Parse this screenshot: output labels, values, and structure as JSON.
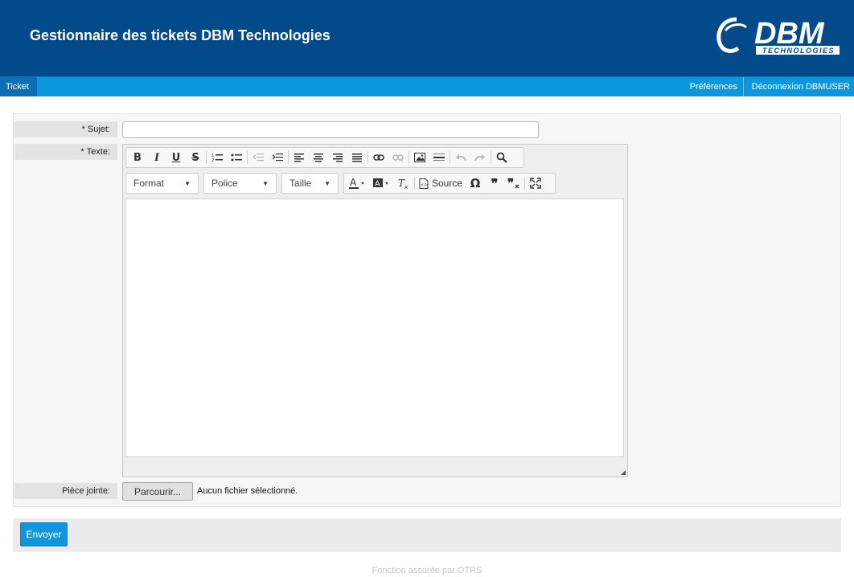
{
  "header": {
    "title": "Gestionnaire des tickets DBM Technologies",
    "logo_text": "DBM",
    "logo_sub": "TECHNOLOGIES"
  },
  "nav": {
    "ticket": "Ticket",
    "preferences": "Préférences",
    "logout": "Déconnexion DBMUSER"
  },
  "form": {
    "required_mark": "*",
    "subject_label": "Sujet:",
    "subject_value": "",
    "text_label": "Texte:",
    "attachment_label": "Pièce jointe:",
    "browse_label": "Parcourir...",
    "file_status": "Aucun fichier sélectionné."
  },
  "editor": {
    "format_label": "Format",
    "font_label": "Police",
    "size_label": "Taille",
    "source_label": "Source",
    "icons": [
      "bold-icon",
      "italic-icon",
      "underline-icon",
      "strike-icon",
      "numbered-list-icon",
      "bullet-list-icon",
      "outdent-icon",
      "indent-icon",
      "align-left-icon",
      "align-center-icon",
      "align-right-icon",
      "justify-icon",
      "link-icon",
      "unlink-icon",
      "image-icon",
      "horizontal-rule-icon",
      "undo-icon",
      "redo-icon",
      "find-icon",
      "text-color-icon",
      "background-color-icon",
      "remove-format-icon",
      "source-icon",
      "special-char-icon",
      "blockquote-icon",
      "remove-quote-icon",
      "maximize-icon"
    ]
  },
  "submit": {
    "label": "Envoyer"
  },
  "footer": {
    "text": "Fonction assurée par OTRS"
  },
  "colors": {
    "header_bg": "#024a8a",
    "nav_bg": "#0c96dd",
    "nav_active": "#0a6fb5",
    "button": "#0e97dc"
  }
}
